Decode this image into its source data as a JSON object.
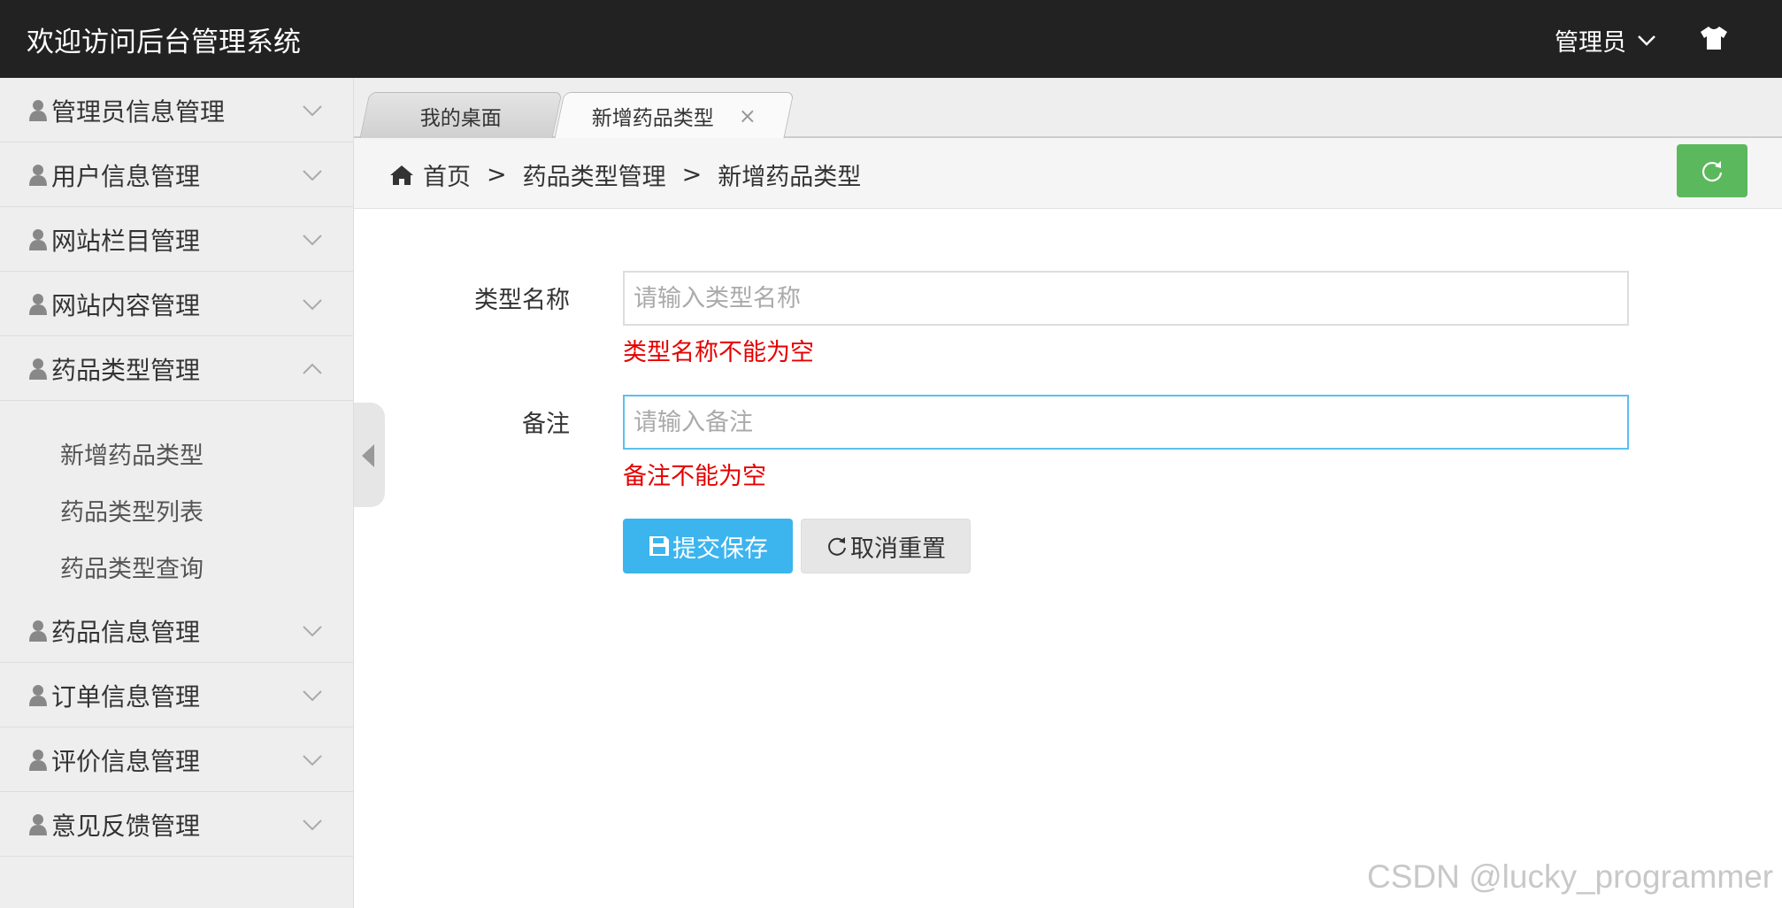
{
  "header": {
    "title": "欢迎访问后台管理系统",
    "user_menu": "管理员",
    "theme_icon": "tshirt-icon"
  },
  "sidebar": {
    "items": [
      {
        "label": "管理员信息管理",
        "expanded": false
      },
      {
        "label": "用户信息管理",
        "expanded": false
      },
      {
        "label": "网站栏目管理",
        "expanded": false
      },
      {
        "label": "网站内容管理",
        "expanded": false
      },
      {
        "label": "药品类型管理",
        "expanded": true,
        "children": [
          "新增药品类型",
          "药品类型列表",
          "药品类型查询"
        ]
      },
      {
        "label": "药品信息管理",
        "expanded": false
      },
      {
        "label": "订单信息管理",
        "expanded": false
      },
      {
        "label": "评价信息管理",
        "expanded": false
      },
      {
        "label": "意见反馈管理",
        "expanded": false
      }
    ]
  },
  "tabs": [
    {
      "label": "我的桌面",
      "active": false
    },
    {
      "label": "新增药品类型",
      "active": true,
      "close": "×"
    }
  ],
  "breadcrumb": {
    "items": [
      "首页",
      "药品类型管理",
      "新增药品类型"
    ],
    "separator": ">"
  },
  "form": {
    "type_name": {
      "label": "类型名称",
      "placeholder": "请输入类型名称",
      "value": "",
      "error": "类型名称不能为空"
    },
    "remark": {
      "label": "备注",
      "placeholder": "请输入备注",
      "value": "",
      "error": "备注不能为空"
    },
    "submit_label": "提交保存",
    "reset_label": "取消重置"
  },
  "watermark": "CSDN @lucky_programmer",
  "colors": {
    "header_bg": "#222222",
    "success": "#5cb85c",
    "primary": "#3cb4ee",
    "error": "#e60000"
  }
}
